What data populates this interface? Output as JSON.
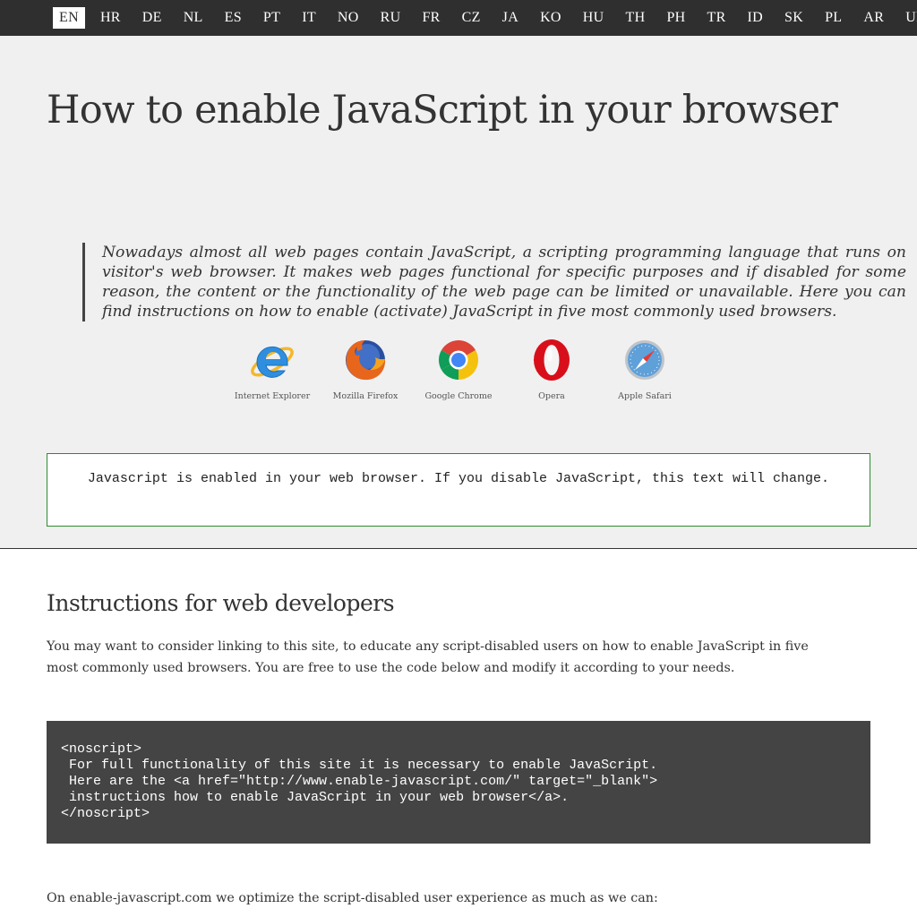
{
  "languages": [
    "EN",
    "HR",
    "DE",
    "NL",
    "ES",
    "PT",
    "IT",
    "NO",
    "RU",
    "FR",
    "CZ",
    "JA",
    "KO",
    "HU",
    "TH",
    "PH",
    "TR",
    "ID",
    "SK",
    "PL",
    "AR",
    "UR"
  ],
  "active_language": "EN",
  "hero": {
    "title": "How to enable JavaScript in your browser",
    "intro": "Nowadays almost all web pages contain JavaScript, a scripting programming language that runs on visitor's web browser. It makes web pages functional for specific purposes and if disabled for some reason, the content or the functionality of the web page can be limited or unavailable. Here you can find instructions on how to enable (activate) JavaScript in five most commonly used browsers."
  },
  "browsers": [
    {
      "label": "Internet Explorer",
      "icon": "internet-explorer-icon"
    },
    {
      "label": "Mozilla Firefox",
      "icon": "firefox-icon"
    },
    {
      "label": "Google Chrome",
      "icon": "chrome-icon"
    },
    {
      "label": "Opera",
      "icon": "opera-icon"
    },
    {
      "label": "Apple Safari",
      "icon": "safari-icon"
    }
  ],
  "status": {
    "text": "Javascript is enabled in your web browser. If you disable JavaScript, this text will change.",
    "border_color": "#2e8b2e"
  },
  "developers": {
    "title": "Instructions for web developers",
    "text": "You may want to consider linking to this site, to educate any script-disabled users on how to enable JavaScript in five most commonly used browsers. You are free to use the code below and modify it according to your needs.",
    "code": "<noscript>\n For full functionality of this site it is necessary to enable JavaScript.\n Here are the <a href=\"http://www.enable-javascript.com/\" target=\"_blank\">\n instructions how to enable JavaScript in your web browser</a>.\n</noscript>",
    "outro": "On enable-javascript.com we optimize the script-disabled user experience as much as we can:"
  },
  "colors": {
    "langbar_bg": "#2f2f2f",
    "hero_bg": "#f0f0f0",
    "code_bg": "#444444",
    "text": "#333333"
  }
}
